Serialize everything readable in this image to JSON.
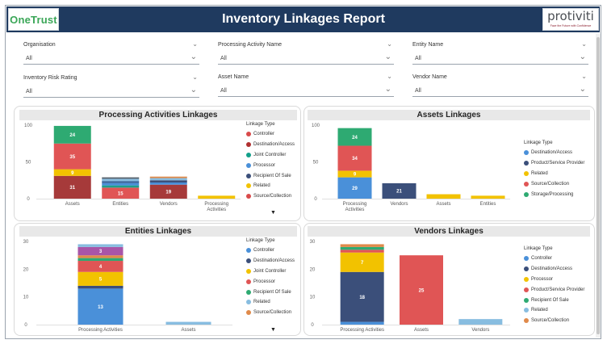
{
  "header": {
    "left_logo": "OneTrust",
    "title": "Inventory Linkages Report",
    "right_logo": "protiviti",
    "right_tagline": "Face the Future with Confidence"
  },
  "filters": [
    {
      "label": "Organisation",
      "value": "All"
    },
    {
      "label": "Processing Activity Name",
      "value": "All"
    },
    {
      "label": "Entity Name",
      "value": "All"
    },
    {
      "label": "Inventory Risk Rating",
      "value": "All"
    },
    {
      "label": "Asset Name",
      "value": "All"
    },
    {
      "label": "Vendor Name",
      "value": "All"
    }
  ],
  "legend_title": "Linkage Type",
  "colors": {
    "Controller": "#4a7ed6",
    "Destination/Access": "#3b4f7a",
    "Joint Controller": "#f2c200",
    "Processor": "#d94a4a",
    "Recipient Of Sale": "#2e9e77",
    "Related": "#8fc6ee",
    "Source/Collection": "#e08a4a",
    "Product/Service Provider": "#d94a4a",
    "Storage/Processing": "#3aa35f",
    "header_bg": "#1f3a5f"
  },
  "chart_data": [
    {
      "id": "pa",
      "title": "Processing Activities Linkages",
      "type": "bar",
      "stacked": true,
      "ylim": [
        0,
        100
      ],
      "yticks": [
        0,
        50,
        100
      ],
      "categories": [
        "Assets",
        "Entities",
        "Vendors",
        "Processing Activities"
      ],
      "legend": [
        "Controller",
        "Destination/Access",
        "Joint Controller",
        "Processor",
        "Recipient Of Sale",
        "Related",
        "Source/Collection"
      ],
      "legend_colors": [
        "#d94a4a",
        "#b03030",
        "#12a08a",
        "#4a90d9",
        "#3b4f7a",
        "#f2c200",
        "#d94a4a"
      ],
      "stacks": [
        [
          {
            "value": 31,
            "color": "#a63a3a",
            "label": "31"
          },
          {
            "value": 9,
            "color": "#f2c200",
            "label": "9"
          },
          {
            "value": 35,
            "color": "#e05555",
            "label": "35"
          },
          {
            "value": 24,
            "color": "#2eaa72",
            "label": "24"
          }
        ],
        [
          {
            "value": 15,
            "color": "#e05555",
            "label": "15"
          },
          {
            "value": 3,
            "color": "#1f9e8a",
            "label": ""
          },
          {
            "value": 3,
            "color": "#4a90d9",
            "label": ""
          },
          {
            "value": 3,
            "color": "#3b6aa0",
            "label": ""
          },
          {
            "value": 3,
            "color": "#88bde0",
            "label": ""
          },
          {
            "value": 2,
            "color": "#56616b",
            "label": ""
          }
        ],
        [
          {
            "value": 19,
            "color": "#a63a3a",
            "label": "19"
          },
          {
            "value": 3,
            "color": "#4a90d9",
            "label": ""
          },
          {
            "value": 3,
            "color": "#3b4f7a",
            "label": ""
          },
          {
            "value": 3,
            "color": "#88bde0",
            "label": ""
          },
          {
            "value": 2,
            "color": "#e08a4a",
            "label": ""
          }
        ],
        [
          {
            "value": 4,
            "color": "#f2c200",
            "label": ""
          }
        ]
      ]
    },
    {
      "id": "as",
      "title": "Assets Linkages",
      "type": "bar",
      "stacked": true,
      "ylim": [
        0,
        100
      ],
      "yticks": [
        0,
        50,
        100
      ],
      "categories": [
        "Processing Activities",
        "Vendors",
        "Assets",
        "Entities"
      ],
      "legend": [
        "Destination/Access",
        "Product/Service Provider",
        "Related",
        "Source/Collection",
        "Storage/Processing"
      ],
      "legend_colors": [
        "#4a90d9",
        "#3b4f7a",
        "#f2c200",
        "#e05555",
        "#2eaa72"
      ],
      "stacks": [
        [
          {
            "value": 29,
            "color": "#4a90d9",
            "label": "29"
          },
          {
            "value": 9,
            "color": "#f2c200",
            "label": "9"
          },
          {
            "value": 34,
            "color": "#e05555",
            "label": "34"
          },
          {
            "value": 24,
            "color": "#2eaa72",
            "label": "24"
          }
        ],
        [
          {
            "value": 21,
            "color": "#3b4f7a",
            "label": "21"
          }
        ],
        [
          {
            "value": 6,
            "color": "#f2c200",
            "label": ""
          }
        ],
        [
          {
            "value": 4,
            "color": "#f2c200",
            "label": ""
          }
        ]
      ]
    },
    {
      "id": "en",
      "title": "Entities Linkages",
      "type": "bar",
      "stacked": true,
      "ylim": [
        0,
        30
      ],
      "yticks": [
        0,
        10,
        20,
        30
      ],
      "categories": [
        "Processing Activities",
        "Assets"
      ],
      "legend": [
        "Controller",
        "Destination/Access",
        "Joint Controller",
        "Processor",
        "Recipient Of Sale",
        "Related",
        "Source/Collection"
      ],
      "legend_colors": [
        "#4a90d9",
        "#3b4f7a",
        "#f2c200",
        "#e05555",
        "#2eaa72",
        "#88bde0",
        "#e08a4a"
      ],
      "stacks": [
        [
          {
            "value": 13,
            "color": "#4a90d9",
            "label": "13"
          },
          {
            "value": 1,
            "color": "#3b4f7a",
            "label": ""
          },
          {
            "value": 5,
            "color": "#f2c200",
            "label": "5"
          },
          {
            "value": 4,
            "color": "#e05555",
            "label": "4"
          },
          {
            "value": 1,
            "color": "#2eaa72",
            "label": ""
          },
          {
            "value": 1,
            "color": "#e08a4a",
            "label": ""
          },
          {
            "value": 3,
            "color": "#a855a8",
            "label": "3"
          },
          {
            "value": 1,
            "color": "#88bde0",
            "label": ""
          }
        ],
        [
          {
            "value": 1,
            "color": "#88bde0",
            "label": ""
          }
        ]
      ]
    },
    {
      "id": "ve",
      "title": "Vendors Linkages",
      "type": "bar",
      "stacked": true,
      "ylim": [
        0,
        30
      ],
      "yticks": [
        0,
        10,
        20,
        30
      ],
      "categories": [
        "Processing Activities",
        "Assets",
        "Vendors"
      ],
      "legend": [
        "Controller",
        "Destination/Access",
        "Processor",
        "Product/Service Provider",
        "Recipient Of Sale",
        "Related",
        "Source/Collection"
      ],
      "legend_colors": [
        "#4a90d9",
        "#3b4f7a",
        "#f2c200",
        "#e05555",
        "#2eaa72",
        "#88bde0",
        "#e08a4a"
      ],
      "stacks": [
        [
          {
            "value": 1,
            "color": "#4a90d9",
            "label": ""
          },
          {
            "value": 18,
            "color": "#3b4f7a",
            "label": "18"
          },
          {
            "value": 7,
            "color": "#f2c200",
            "label": "7"
          },
          {
            "value": 1,
            "color": "#e05555",
            "label": ""
          },
          {
            "value": 1,
            "color": "#2eaa72",
            "label": ""
          },
          {
            "value": 1,
            "color": "#e08a4a",
            "label": ""
          }
        ],
        [
          {
            "value": 25,
            "color": "#e05555",
            "label": "25"
          }
        ],
        [
          {
            "value": 2,
            "color": "#88bde0",
            "label": ""
          }
        ]
      ]
    }
  ]
}
